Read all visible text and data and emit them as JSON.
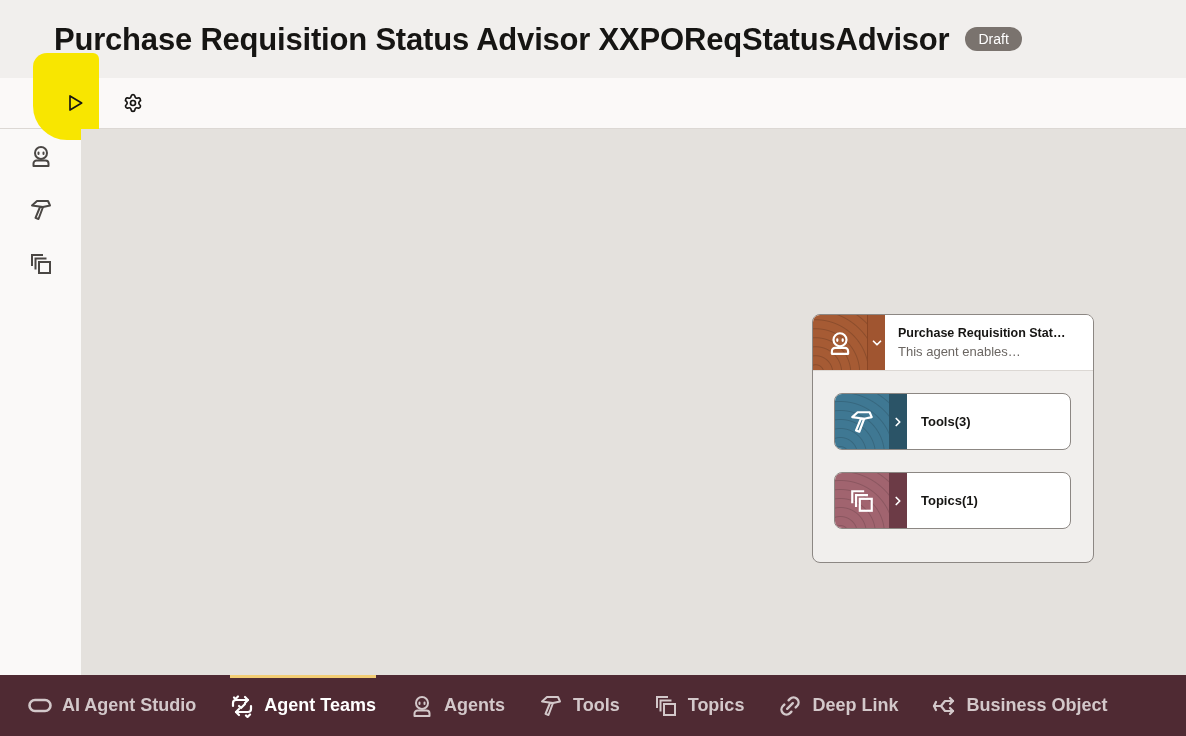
{
  "header": {
    "title": "Purchase Requisition Status Advisor XXPOReqStatusAdvisor",
    "badge": "Draft"
  },
  "toolbar": {
    "items": [
      {
        "kind": "run",
        "highlighted": true
      },
      {
        "kind": "settings",
        "highlighted": false
      }
    ]
  },
  "side_rail": {
    "items": [
      {
        "kind": "agents"
      },
      {
        "kind": "tools"
      },
      {
        "kind": "topics"
      }
    ]
  },
  "canvas": {
    "agent_node": {
      "title": "Purchase Requisition Stat…",
      "description": "This agent enables…",
      "expanded": true,
      "children": [
        {
          "kind": "tools",
          "label": "Tools(3)",
          "expanded": false
        },
        {
          "kind": "topics",
          "label": "Topics(1)",
          "expanded": false
        }
      ]
    }
  },
  "bottom_nav": {
    "items": [
      {
        "kind": "studio",
        "label": "AI Agent Studio",
        "selected": false
      },
      {
        "kind": "teams",
        "label": "Agent Teams",
        "selected": true
      },
      {
        "kind": "agents",
        "label": "Agents",
        "selected": false
      },
      {
        "kind": "tools",
        "label": "Tools",
        "selected": false
      },
      {
        "kind": "topics",
        "label": "Topics",
        "selected": false
      },
      {
        "kind": "deeplink",
        "label": "Deep Link",
        "selected": false
      },
      {
        "kind": "business",
        "label": "Business Object",
        "selected": false
      }
    ]
  }
}
